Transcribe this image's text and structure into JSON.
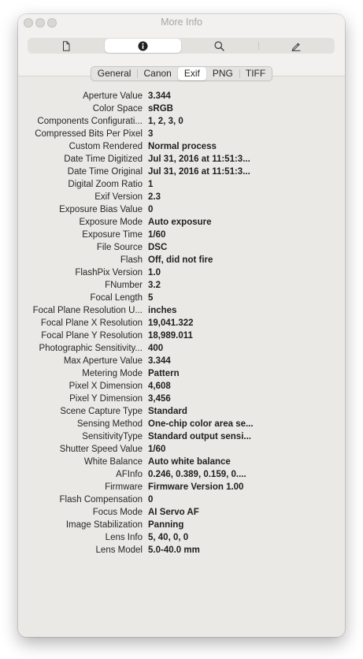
{
  "window": {
    "title": "More Info"
  },
  "toolbar": {
    "items": [
      {
        "icon": "document-icon"
      },
      {
        "icon": "info-icon"
      },
      {
        "icon": "search-icon"
      },
      {
        "icon": "pencil-icon"
      }
    ]
  },
  "tabs": [
    "General",
    "Canon",
    "Exif",
    "PNG",
    "TIFF"
  ],
  "active_tab": "Exif",
  "rows": [
    {
      "key": "Aperture Value",
      "value": "3.344"
    },
    {
      "key": "Color Space",
      "value": "sRGB"
    },
    {
      "key": "Components Configurati...",
      "value": "1, 2, 3, 0"
    },
    {
      "key": "Compressed Bits Per Pixel",
      "value": "3"
    },
    {
      "key": "Custom Rendered",
      "value": "Normal process"
    },
    {
      "key": "Date Time Digitized",
      "value": "Jul 31, 2016 at 11:51:3..."
    },
    {
      "key": "Date Time Original",
      "value": "Jul 31, 2016 at 11:51:3..."
    },
    {
      "key": "Digital Zoom Ratio",
      "value": "1"
    },
    {
      "key": "Exif Version",
      "value": "2.3"
    },
    {
      "key": "Exposure Bias Value",
      "value": "0"
    },
    {
      "key": "Exposure Mode",
      "value": "Auto exposure"
    },
    {
      "key": "Exposure Time",
      "value": "1/60"
    },
    {
      "key": "File Source",
      "value": "DSC"
    },
    {
      "key": "Flash",
      "value": "Off, did not fire"
    },
    {
      "key": "FlashPix Version",
      "value": "1.0"
    },
    {
      "key": "FNumber",
      "value": "3.2"
    },
    {
      "key": "Focal Length",
      "value": "5"
    },
    {
      "key": "Focal Plane Resolution U...",
      "value": "inches"
    },
    {
      "key": "Focal Plane X Resolution",
      "value": "19,041.322"
    },
    {
      "key": "Focal Plane Y Resolution",
      "value": "18,989.011"
    },
    {
      "key": "Photographic Sensitivity...",
      "value": "400"
    },
    {
      "key": "Max Aperture Value",
      "value": "3.344"
    },
    {
      "key": "Metering Mode",
      "value": "Pattern"
    },
    {
      "key": "Pixel X Dimension",
      "value": "4,608"
    },
    {
      "key": "Pixel Y Dimension",
      "value": "3,456"
    },
    {
      "key": "Scene Capture Type",
      "value": "Standard"
    },
    {
      "key": "Sensing Method",
      "value": "One-chip color area se..."
    },
    {
      "key": "SensitivityType",
      "value": "Standard output sensi..."
    },
    {
      "key": "Shutter Speed Value",
      "value": "1/60"
    },
    {
      "key": "White Balance",
      "value": "Auto white balance"
    },
    {
      "key": "AFInfo",
      "value": "0.246, 0.389, 0.159, 0...."
    },
    {
      "key": "Firmware",
      "value": "Firmware Version 1.00"
    },
    {
      "key": "Flash Compensation",
      "value": "0"
    },
    {
      "key": "Focus Mode",
      "value": "AI Servo AF"
    },
    {
      "key": "Image Stabilization",
      "value": "Panning"
    },
    {
      "key": "Lens Info",
      "value": "5, 40, 0, 0"
    },
    {
      "key": "Lens Model",
      "value": "5.0-40.0 mm"
    }
  ]
}
